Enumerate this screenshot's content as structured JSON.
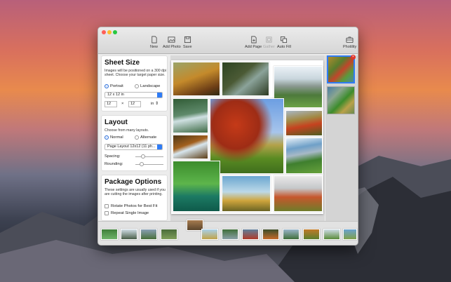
{
  "window": {
    "buttons": {
      "close": "#ff5f57",
      "minimize": "#febc2e",
      "zoom": "#28c840"
    }
  },
  "toolbar": {
    "left": [
      {
        "label": "New",
        "icon": "document-icon",
        "enabled": true
      },
      {
        "label": "Add Photo",
        "icon": "photo-add-icon",
        "enabled": true
      },
      {
        "label": "Save",
        "icon": "floppy-disk-icon",
        "enabled": true
      }
    ],
    "right": [
      {
        "label": "Add Page",
        "icon": "page-add-icon",
        "enabled": true
      },
      {
        "label": "Gather",
        "icon": "gather-icon",
        "enabled": false
      },
      {
        "label": "Auto Fill",
        "icon": "autofill-icon",
        "enabled": true
      }
    ],
    "photility": {
      "label": "Photility",
      "icon": "briefcase-icon"
    }
  },
  "sheet_size": {
    "title": "Sheet Size",
    "description": "Images will be positioned on a 300 dpi sheet. Choose your target paper size.",
    "orientation_options": [
      "Portrait",
      "Landscape"
    ],
    "orientation_selected": "Portrait",
    "preset": "12 x 12 in",
    "width": "12",
    "times": "×",
    "height": "12",
    "unit": "in"
  },
  "layout": {
    "title": "Layout",
    "description": "Choose from many layouts.",
    "mode_options": [
      "Normal",
      "Alternate"
    ],
    "mode_selected": "Normal",
    "preset": "Page Layout 12x12 (11 ph...",
    "spacing_label": "Spacing:",
    "spacing_value": 0.25,
    "rounding_label": "Rounding:",
    "rounding_value": 0.1
  },
  "package": {
    "title": "Package Options",
    "description": "These settings are usually used if you are cutting the images after printing.",
    "options": [
      {
        "label": "Rotate Photos for Best Fit",
        "checked": false
      },
      {
        "label": "Repeat Single Image",
        "checked": false
      }
    ]
  },
  "colors": {
    "accent": "#2f7cf6",
    "badge": "#e0352b"
  }
}
